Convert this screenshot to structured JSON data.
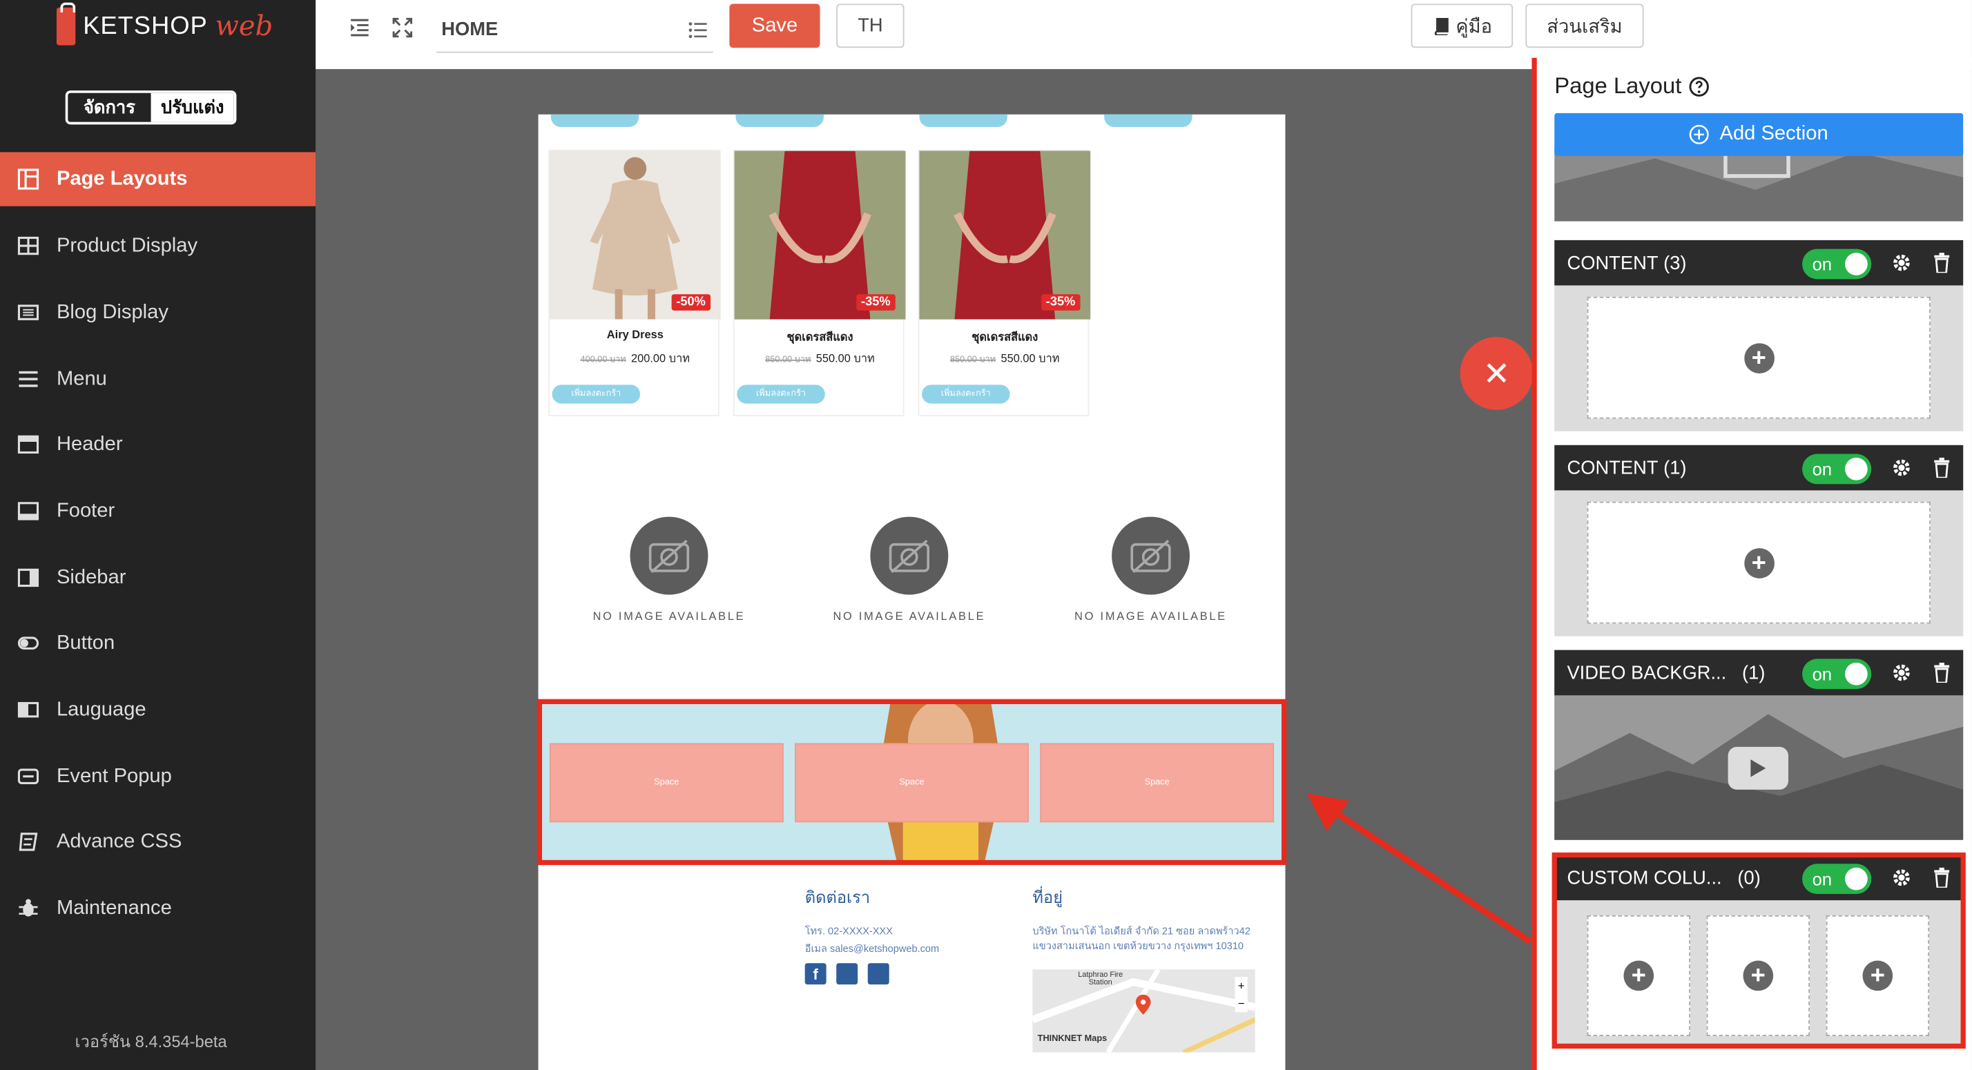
{
  "brand": {
    "ketshop": "KETSHOP",
    "web": "web"
  },
  "mode_toggle": {
    "manage": "จัดการ",
    "customize": "ปรับแต่ง"
  },
  "sidebar": {
    "items": [
      {
        "label": "Page Layouts",
        "icon": "layout-icon",
        "active": true
      },
      {
        "label": "Product Display",
        "icon": "grid-icon"
      },
      {
        "label": "Blog Display",
        "icon": "list-icon"
      },
      {
        "label": "Menu",
        "icon": "menu-icon"
      },
      {
        "label": "Header",
        "icon": "header-icon"
      },
      {
        "label": "Footer",
        "icon": "footer-icon"
      },
      {
        "label": "Sidebar",
        "icon": "sidebar-icon"
      },
      {
        "label": "Button",
        "icon": "toggle-icon"
      },
      {
        "label": "Lauguage",
        "icon": "language-icon"
      },
      {
        "label": "Event Popup",
        "icon": "popup-icon"
      },
      {
        "label": "Advance CSS",
        "icon": "css-icon"
      },
      {
        "label": "Maintenance",
        "icon": "bug-icon"
      }
    ],
    "version": "เวอร์ชัน 8.4.354-beta"
  },
  "topbar": {
    "page": "HOME",
    "save": "Save",
    "lang": "TH",
    "manual": "คู่มือ",
    "addons": "ส่วนเสริม"
  },
  "preview": {
    "products": [
      {
        "name": "Airy Dress",
        "old_price": "400.00 บาท",
        "price": "200.00 บาท",
        "discount": "-50%",
        "cart": "เพิ่มลงตะกร้า",
        "color": "#d9c2ad"
      },
      {
        "name": "ชุดเดรสสีแดง",
        "old_price": "850.00 บาท",
        "price": "550.00 บาท",
        "discount": "-35%",
        "cart": "เพิ่มลงตะกร้า",
        "color": "#a91f2a"
      },
      {
        "name": "ชุดเดรสสีแดง",
        "old_price": "850.00 บาท",
        "price": "550.00 บาท",
        "discount": "-35%",
        "cart": "เพิ่มลงตะกร้า",
        "color": "#a91f2a"
      }
    ],
    "no_image": "NO IMAGE AVAILABLE",
    "space": "Space",
    "footer": {
      "contact_title": "ติดต่อเรา",
      "phone": "โทร. 02-XXXX-XXX",
      "email": "อีเมล sales@ketshopweb.com",
      "address_title": "ที่อยู่",
      "address1": "บริษัท โกนาโต้ ไอเดียส์ จำกัด 21 ซอย ลาดพร้าว42",
      "address2": "แขวงสามเสนนอก เขตห้วยขวาง กรุงเทพฯ 10310",
      "map_label": "Latphrao Fire Station",
      "map_brand": "THINKNET Maps"
    }
  },
  "panel": {
    "title": "Page Layout",
    "add_section": "Add Section",
    "switch_on": "on",
    "sections": [
      {
        "name": "CONTENT",
        "count": "(3)"
      },
      {
        "name": "CONTENT",
        "count": "(1)"
      },
      {
        "name": "VIDEO BACKGR...",
        "count": "(1)"
      },
      {
        "name": "CUSTOM COLU...",
        "count": "(0)"
      }
    ]
  }
}
